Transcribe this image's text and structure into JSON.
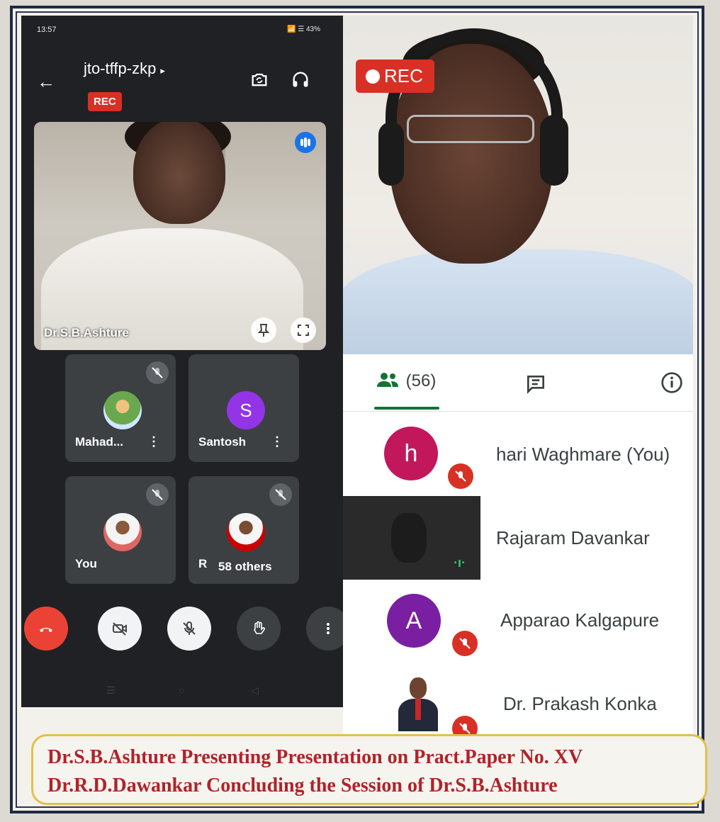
{
  "status_bar": {
    "time": "13:57",
    "right": "📶 ☰ 43%"
  },
  "meeting": {
    "code": "jto-tffp-zkp",
    "rec_badge": "REC"
  },
  "main_tile": {
    "name": "Dr.S.B.Ashture"
  },
  "grid_tiles": [
    {
      "name": "Mahad...",
      "avatar_letter": "",
      "avatar_color": "#6aa84f"
    },
    {
      "name": "Santosh",
      "avatar_letter": "S",
      "avatar_color": "#9334e6"
    },
    {
      "name": "You",
      "avatar_letter": "",
      "avatar_color": "#e06666"
    },
    {
      "name": "R",
      "avatar_letter": "",
      "avatar_color": "#cc0000",
      "others": "58 others"
    }
  ],
  "controls": [
    "end-call",
    "camera-off",
    "mic-off",
    "raise-hand",
    "more-options"
  ],
  "presenter_video": {
    "rec_label": "REC"
  },
  "panel": {
    "people_tab": "(56)",
    "participants": [
      {
        "name": "hari Waghmare (You)",
        "initial": "h",
        "color": "#c2185b",
        "muted": true
      },
      {
        "name": "Rajaram Davankar",
        "initial": "",
        "color": "#2a2a2a",
        "muted": false
      },
      {
        "name": "Apparao Kalgapure",
        "initial": "A",
        "color": "#7b1fa2",
        "muted": true
      },
      {
        "name": "Dr. Prakash Konka",
        "initial": "",
        "color": "#ffffff",
        "muted": true
      }
    ]
  },
  "caption": {
    "line1": "Dr.S.B.Ashture Presenting Presentation on Pract.Paper No. XV",
    "line2": "Dr.R.D.Dawankar Concluding the Session of Dr.S.B.Ashture"
  },
  "colors": {
    "rec": "#d93025",
    "caption_text": "#b0232a",
    "caption_border": "#e3c048",
    "people_tab_accent": "#137333"
  }
}
